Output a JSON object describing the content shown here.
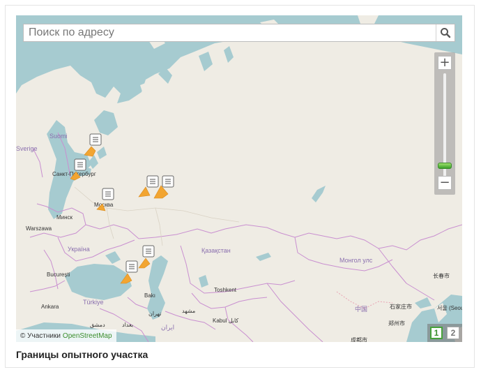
{
  "map": {
    "search_placeholder": "Поиск по адресу",
    "attribution_prefix": "© Участники",
    "attribution_link": "OpenStreetMap",
    "labels": {
      "suomi": "Suomi",
      "sverige": "Sverige",
      "spb": "Санкт-Петербург",
      "moskva": "Москва",
      "minsk": "Минск",
      "warszawa": "Warszawa",
      "ukraina": "Україна",
      "bucuresti": "București",
      "turkiye": "Türkiye",
      "ankara": "Ankara",
      "baku": "Bakı",
      "tehran": "تهران",
      "mashhad": "مشهد",
      "baghdad": "بغداد",
      "dimashq": "دمشق",
      "iran": "ایران",
      "kazakhstan": "Қазақстан",
      "tashkent": "Toshkent",
      "kabul": "Kabul کابل",
      "mongol": "Монгол улс",
      "china": "中国",
      "shijiazhuang": "石家庄市",
      "zhengzhou": "郑州市",
      "chengdu": "成都市",
      "changchun": "长春市",
      "seoul": "서울 (Seoul)"
    },
    "markers": [
      {
        "name": "marker-karelia"
      },
      {
        "name": "marker-spb"
      },
      {
        "name": "marker-moscow"
      },
      {
        "name": "marker-volga-1"
      },
      {
        "name": "marker-volga-2"
      },
      {
        "name": "marker-caspian-1"
      },
      {
        "name": "marker-caspian-2"
      }
    ]
  },
  "pager": {
    "pages": [
      "1",
      "2"
    ],
    "active": "1"
  },
  "caption": "Границы опытного участка",
  "colors": {
    "sea": "#a6cbd0",
    "land": "#efece4",
    "border": "#c98fd0",
    "polygon": "#f2a531",
    "accent": "#47a23a"
  }
}
